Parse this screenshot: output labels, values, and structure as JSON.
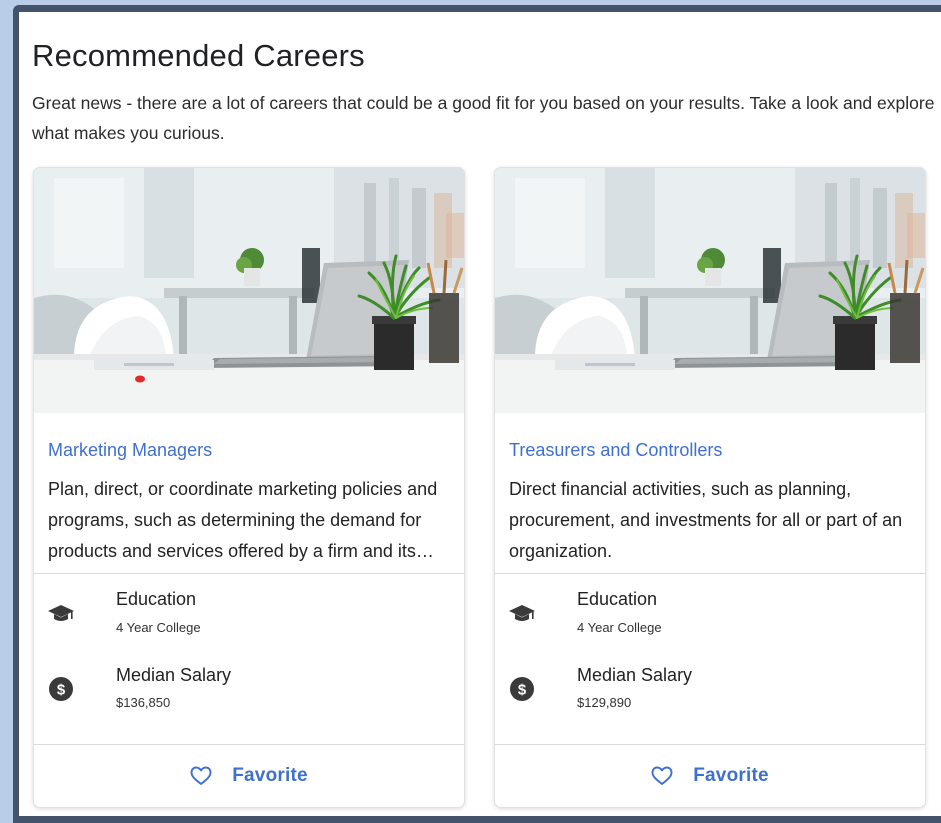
{
  "page": {
    "title": "Recommended Careers",
    "intro": "Great news - there are a lot of careers that could be a good fit for you based on your results. Take a look and explore what makes you curious."
  },
  "cards": [
    {
      "title": "Marketing Managers",
      "description": "Plan, direct, or coordinate marketing policies and programs, such as determining the demand for products and services offered by a firm and its competitors, and identify potential customers.",
      "education_label": "Education",
      "education_value": "4 Year College",
      "salary_label": "Median Salary",
      "salary_value": "$136,850",
      "favorite_label": "Favorite",
      "image_icon": "office-desk-laptop-plant-photo"
    },
    {
      "title": "Treasurers and Controllers",
      "description": "Direct financial activities, such as planning, procurement, and investments for all or part of an organization.",
      "education_label": "Education",
      "education_value": "4 Year College",
      "salary_label": "Median Salary",
      "salary_value": "$129,890",
      "favorite_label": "Favorite",
      "image_icon": "office-desk-laptop-plant-photo"
    }
  ],
  "icons": {
    "education": "graduation-cap-icon",
    "salary": "dollar-circle-icon",
    "favorite": "heart-outline-icon"
  },
  "colors": {
    "accent": "#3f6fcf",
    "frame": "#42536b",
    "page_background": "#b9cde8",
    "icon": "#3a3a3a"
  }
}
